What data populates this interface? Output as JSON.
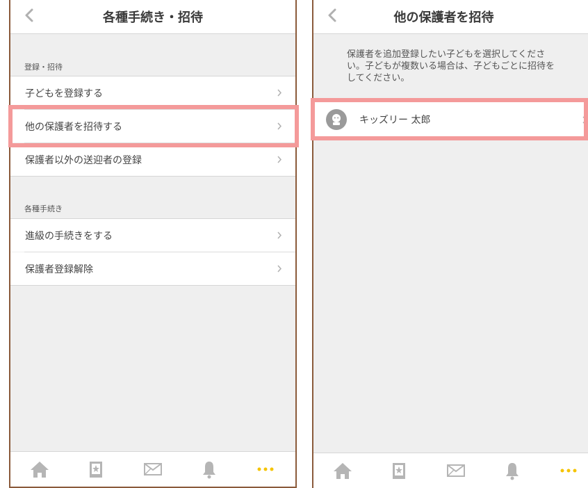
{
  "left_screen": {
    "title": "各種手続き・招待",
    "sections": [
      {
        "header": "登録・招待",
        "items": [
          "子どもを登録する",
          "他の保護者を招待する",
          "保護者以外の送迎者の登録"
        ]
      },
      {
        "header": "各種手続き",
        "items": [
          "進級の手続きをする",
          "保護者登録解除"
        ]
      }
    ]
  },
  "right_screen": {
    "title": "他の保護者を招待",
    "description": "保護者を追加登録したい子どもを選択してください。子どもが複数いる場合は、子どもごとに招待をしてください。",
    "children": [
      {
        "name": "キッズリー 太郎"
      }
    ]
  },
  "tabbar": {
    "tabs": [
      "home-icon",
      "contacts-icon",
      "mail-icon",
      "bell-icon",
      "more-icon"
    ],
    "active_tab": "more-icon",
    "active_color": "#f5c400",
    "inactive_color": "#b5b5b5"
  },
  "colors": {
    "highlight": "#f49a9a",
    "background": "#efefef",
    "frame": "#8a5a3a"
  }
}
